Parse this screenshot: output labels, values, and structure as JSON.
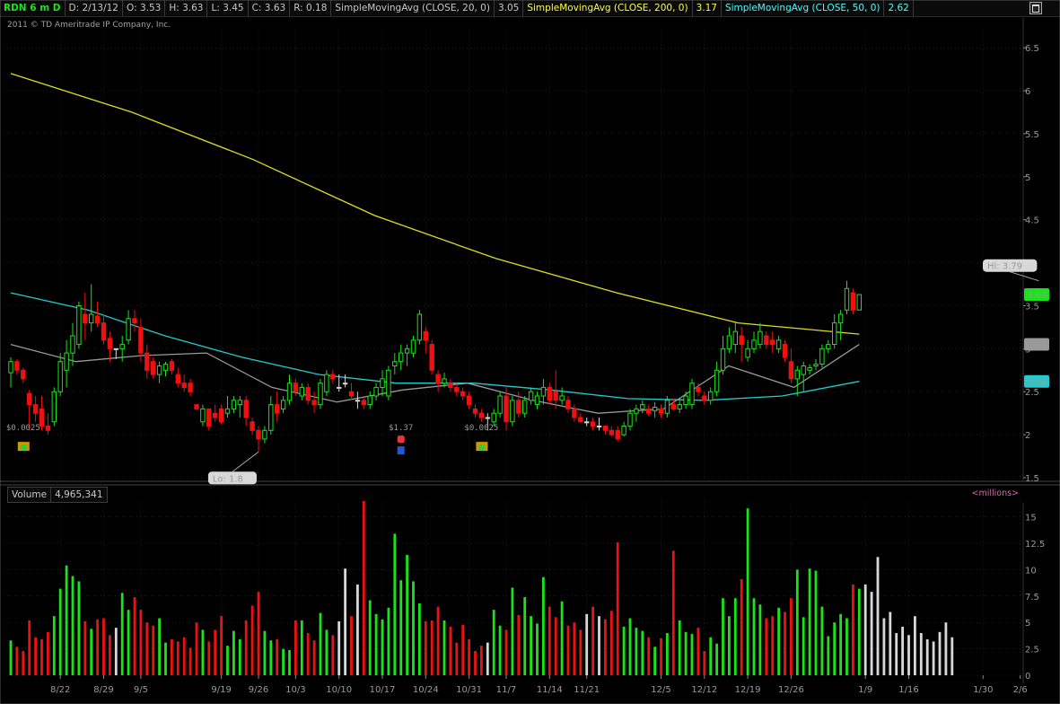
{
  "header": {
    "symbol": "RDN 6 m D",
    "date": "D: 2/13/12",
    "open": "O: 3.53",
    "high": "H: 3.63",
    "low": "L: 3.45",
    "close": "C: 3.63",
    "range": "R: 0.18",
    "sma20_label": "SimpleMovingAvg (CLOSE, 20, 0)",
    "sma20_value": "3.05",
    "sma200_label": "SimpleMovingAvg (CLOSE, 200, 0)",
    "sma200_value": "3.17",
    "sma50_label": "SimpleMovingAvg (CLOSE, 50, 0)",
    "sma50_value": "2.62"
  },
  "copyright": "2011 © TD Ameritrade IP Company, Inc.",
  "volume_header": {
    "label": "Volume",
    "value": "4,965,341",
    "units": "<millions>"
  },
  "colors": {
    "up": "#19e319",
    "down": "#ee1111",
    "flat": "#d8d8d8",
    "sma200": "#dddd22",
    "sma50": "#22cccc",
    "sma20": "#999999",
    "grid": "#3a3a3a"
  },
  "chart_data": [
    {
      "type": "candlestick",
      "title": "RDN 6 m D",
      "ylim": [
        1.5,
        6.7
      ],
      "y_ticks": [
        1.5,
        2,
        2.5,
        3,
        3.5,
        4,
        4.5,
        5,
        5.5,
        6,
        6.5
      ],
      "y_tick_labels": [
        "1.5",
        "2",
        "2.5",
        "3",
        "3.5",
        "4",
        "4.5",
        "5",
        "5.5",
        "6",
        "6.5"
      ],
      "x_tick_labels": [
        {
          "label": "8/22",
          "bar": 8
        },
        {
          "label": "8/29",
          "bar": 15
        },
        {
          "label": "9/5",
          "bar": 21
        },
        {
          "label": "9/19",
          "bar": 34
        },
        {
          "label": "9/26",
          "bar": 40
        },
        {
          "label": "10/3",
          "bar": 46
        },
        {
          "label": "10/10",
          "bar": 53
        },
        {
          "label": "10/17",
          "bar": 60
        },
        {
          "label": "10/24",
          "bar": 67
        },
        {
          "label": "10/31",
          "bar": 74
        },
        {
          "label": "11/7",
          "bar": 80
        },
        {
          "label": "11/14",
          "bar": 87
        },
        {
          "label": "11/21",
          "bar": 93
        },
        {
          "label": "12/5",
          "bar": 105
        },
        {
          "label": "12/12",
          "bar": 112
        },
        {
          "label": "12/19",
          "bar": 119
        },
        {
          "label": "12/26",
          "bar": 126
        },
        {
          "label": "1/9",
          "bar": 138
        },
        {
          "label": "1/16",
          "bar": 145
        },
        {
          "label": "1/30",
          "bar": 157
        },
        {
          "label": "2/6",
          "bar": 163
        }
      ],
      "ohlc": [
        [
          2.72,
          2.9,
          2.55,
          2.85
        ],
        [
          2.85,
          2.88,
          2.7,
          2.75
        ],
        [
          2.75,
          2.78,
          2.6,
          2.65
        ],
        [
          2.48,
          2.52,
          2.05,
          2.35
        ],
        [
          2.35,
          2.45,
          2.15,
          2.25
        ],
        [
          2.3,
          2.45,
          2.05,
          2.1
        ],
        [
          2.1,
          2.25,
          2.0,
          2.05
        ],
        [
          2.15,
          2.55,
          2.1,
          2.5
        ],
        [
          2.5,
          2.95,
          2.45,
          2.85
        ],
        [
          2.75,
          3.1,
          2.55,
          2.95
        ],
        [
          2.95,
          3.3,
          2.8,
          3.15
        ],
        [
          3.05,
          3.55,
          3.0,
          3.5
        ],
        [
          3.4,
          3.65,
          3.1,
          3.3
        ],
        [
          3.3,
          3.75,
          3.2,
          3.4
        ],
        [
          3.38,
          3.55,
          3.25,
          3.3
        ],
        [
          3.3,
          3.4,
          3.05,
          3.1
        ],
        [
          3.12,
          3.2,
          2.85,
          3.0
        ],
        [
          3.0,
          3.0,
          2.88,
          3.0
        ],
        [
          3.0,
          3.15,
          2.85,
          3.05
        ],
        [
          3.1,
          3.45,
          3.05,
          3.35
        ],
        [
          3.35,
          3.45,
          3.2,
          3.3
        ],
        [
          3.25,
          3.35,
          2.85,
          2.95
        ],
        [
          2.95,
          3.05,
          2.65,
          2.75
        ],
        [
          2.85,
          2.9,
          2.65,
          2.7
        ],
        [
          2.7,
          2.85,
          2.6,
          2.8
        ],
        [
          2.75,
          2.85,
          2.68,
          2.82
        ],
        [
          2.85,
          2.88,
          2.7,
          2.75
        ],
        [
          2.7,
          2.78,
          2.55,
          2.6
        ],
        [
          2.6,
          2.7,
          2.5,
          2.55
        ],
        [
          2.6,
          2.65,
          2.45,
          2.5
        ],
        [
          2.35,
          2.35,
          2.3,
          2.3
        ],
        [
          2.15,
          2.35,
          2.1,
          2.3
        ],
        [
          2.3,
          2.3,
          2.05,
          2.1
        ],
        [
          2.25,
          2.35,
          2.15,
          2.2
        ],
        [
          2.3,
          2.35,
          2.12,
          2.15
        ],
        [
          2.25,
          2.45,
          2.2,
          2.3
        ],
        [
          2.3,
          2.45,
          2.25,
          2.4
        ],
        [
          2.35,
          2.45,
          2.2,
          2.4
        ],
        [
          2.4,
          2.45,
          2.1,
          2.2
        ],
        [
          2.15,
          2.2,
          2.0,
          2.05
        ],
        [
          2.05,
          2.1,
          1.8,
          1.95
        ],
        [
          1.95,
          2.1,
          1.9,
          2.05
        ],
        [
          2.05,
          2.45,
          2.0,
          2.35
        ],
        [
          2.35,
          2.5,
          2.15,
          2.25
        ],
        [
          2.3,
          2.45,
          2.25,
          2.4
        ],
        [
          2.4,
          2.7,
          2.35,
          2.6
        ],
        [
          2.6,
          2.65,
          2.45,
          2.5
        ],
        [
          2.45,
          2.6,
          2.4,
          2.55
        ],
        [
          2.55,
          2.6,
          2.35,
          2.4
        ],
        [
          2.4,
          2.5,
          2.25,
          2.35
        ],
        [
          2.35,
          2.65,
          2.3,
          2.6
        ],
        [
          2.5,
          2.75,
          2.45,
          2.7
        ],
        [
          2.7,
          2.75,
          2.6,
          2.65
        ],
        [
          2.55,
          2.7,
          2.5,
          2.55
        ],
        [
          2.6,
          2.7,
          2.55,
          2.6
        ],
        [
          2.5,
          2.6,
          2.4,
          2.45
        ],
        [
          2.4,
          2.5,
          2.3,
          2.4
        ],
        [
          2.4,
          2.45,
          2.3,
          2.35
        ],
        [
          2.35,
          2.5,
          2.3,
          2.45
        ],
        [
          2.45,
          2.6,
          2.4,
          2.55
        ],
        [
          2.55,
          2.75,
          2.45,
          2.65
        ],
        [
          2.45,
          2.8,
          2.4,
          2.75
        ],
        [
          2.8,
          2.95,
          2.7,
          2.85
        ],
        [
          2.85,
          3.05,
          2.75,
          2.95
        ],
        [
          2.95,
          3.05,
          2.8,
          3.0
        ],
        [
          2.95,
          3.15,
          2.9,
          3.1
        ],
        [
          3.1,
          3.45,
          3.05,
          3.4
        ],
        [
          3.2,
          3.25,
          2.95,
          3.1
        ],
        [
          3.05,
          3.1,
          2.7,
          2.75
        ],
        [
          2.7,
          2.75,
          2.5,
          2.6
        ],
        [
          2.6,
          2.72,
          2.55,
          2.65
        ],
        [
          2.6,
          2.65,
          2.5,
          2.55
        ],
        [
          2.55,
          2.6,
          2.45,
          2.5
        ],
        [
          2.5,
          2.55,
          2.4,
          2.45
        ],
        [
          2.45,
          2.5,
          2.3,
          2.35
        ],
        [
          2.3,
          2.35,
          2.2,
          2.25
        ],
        [
          2.25,
          2.3,
          2.15,
          2.2
        ],
        [
          2.2,
          2.25,
          2.05,
          2.2
        ],
        [
          2.15,
          2.3,
          2.1,
          2.25
        ],
        [
          2.25,
          2.5,
          2.2,
          2.45
        ],
        [
          2.45,
          2.55,
          2.05,
          2.15
        ],
        [
          2.15,
          2.45,
          2.1,
          2.4
        ],
        [
          2.4,
          2.5,
          2.2,
          2.25
        ],
        [
          2.25,
          2.45,
          2.2,
          2.4
        ],
        [
          2.4,
          2.55,
          2.35,
          2.5
        ],
        [
          2.35,
          2.5,
          2.3,
          2.45
        ],
        [
          2.45,
          2.65,
          2.35,
          2.55
        ],
        [
          2.55,
          2.6,
          2.35,
          2.4
        ],
        [
          2.5,
          2.75,
          2.3,
          2.4
        ],
        [
          2.4,
          2.55,
          2.35,
          2.45
        ],
        [
          2.4,
          2.45,
          2.25,
          2.3
        ],
        [
          2.3,
          2.35,
          2.15,
          2.2
        ],
        [
          2.2,
          2.25,
          2.15,
          2.15
        ],
        [
          2.15,
          2.2,
          2.1,
          2.15
        ],
        [
          2.15,
          2.2,
          2.05,
          2.1
        ],
        [
          2.1,
          2.2,
          2.05,
          2.1
        ],
        [
          2.1,
          2.1,
          2.0,
          2.05
        ],
        [
          2.05,
          2.1,
          1.98,
          2.0
        ],
        [
          2.05,
          2.1,
          1.92,
          1.95
        ],
        [
          2.0,
          2.15,
          1.98,
          2.1
        ],
        [
          2.1,
          2.3,
          2.05,
          2.25
        ],
        [
          2.25,
          2.35,
          2.15,
          2.3
        ],
        [
          2.3,
          2.4,
          2.25,
          2.35
        ],
        [
          2.3,
          2.35,
          2.22,
          2.25
        ],
        [
          2.28,
          2.38,
          2.2,
          2.32
        ],
        [
          2.3,
          2.35,
          2.2,
          2.25
        ],
        [
          2.25,
          2.45,
          2.2,
          2.4
        ],
        [
          2.35,
          2.42,
          2.28,
          2.3
        ],
        [
          2.3,
          2.42,
          2.25,
          2.35
        ],
        [
          2.35,
          2.5,
          2.3,
          2.45
        ],
        [
          2.35,
          2.65,
          2.3,
          2.6
        ],
        [
          2.55,
          2.6,
          2.45,
          2.5
        ],
        [
          2.45,
          2.5,
          2.35,
          2.4
        ],
        [
          2.4,
          2.55,
          2.35,
          2.5
        ],
        [
          2.5,
          2.85,
          2.45,
          2.75
        ],
        [
          2.75,
          3.15,
          2.7,
          3.0
        ],
        [
          3.0,
          3.25,
          2.95,
          3.15
        ],
        [
          3.05,
          3.3,
          2.95,
          3.2
        ],
        [
          3.15,
          3.25,
          2.85,
          3.05
        ],
        [
          2.9,
          3.1,
          2.85,
          3.0
        ],
        [
          3.0,
          3.2,
          2.95,
          3.1
        ],
        [
          3.05,
          3.3,
          3.0,
          3.2
        ],
        [
          3.15,
          3.2,
          3.0,
          3.05
        ],
        [
          3.1,
          3.2,
          2.95,
          3.05
        ],
        [
          3.0,
          3.15,
          2.95,
          3.1
        ],
        [
          3.05,
          3.1,
          2.85,
          2.9
        ],
        [
          2.85,
          3.0,
          2.6,
          2.65
        ],
        [
          2.65,
          2.8,
          2.45,
          2.75
        ],
        [
          2.7,
          2.85,
          2.5,
          2.8
        ],
        [
          2.75,
          2.82,
          2.7,
          2.78
        ],
        [
          2.8,
          2.88,
          2.75,
          2.82
        ],
        [
          2.82,
          3.05,
          2.78,
          3.0
        ],
        [
          3.0,
          3.1,
          2.95,
          3.05
        ],
        [
          3.05,
          3.4,
          3.0,
          3.3
        ],
        [
          3.3,
          3.45,
          3.1,
          3.4
        ],
        [
          3.45,
          3.79,
          3.4,
          3.7
        ],
        [
          3.65,
          3.7,
          3.4,
          3.45
        ],
        [
          3.45,
          3.63,
          3.45,
          3.63
        ]
      ],
      "series": [
        {
          "name": "SimpleMovingAvg (CLOSE, 200, 0)",
          "values": [
            6.2,
            5.75,
            5.2,
            4.55,
            4.05,
            3.65,
            3.3,
            3.17
          ]
        },
        {
          "name": "SimpleMovingAvg (CLOSE, 50, 0)",
          "values": [
            3.65,
            3.45,
            3.15,
            2.9,
            2.7,
            2.6,
            2.6,
            2.52,
            2.42,
            2.4,
            2.45,
            2.62
          ]
        },
        {
          "name": "SimpleMovingAvg (CLOSE, 20, 0)",
          "values": [
            3.05,
            2.85,
            2.92,
            2.95,
            2.55,
            2.38,
            2.52,
            2.6,
            2.4,
            2.25,
            2.3,
            2.8,
            2.55,
            3.05
          ]
        }
      ],
      "annotations": [
        {
          "label": "Hi: 3.79",
          "bar": 166,
          "value": 3.79
        },
        {
          "label": "Lo: 1.8",
          "bar": 40,
          "value": 1.8
        },
        {
          "label": "$0.0025",
          "bar": 2,
          "value": 2.0,
          "icon": "dividend-icon"
        },
        {
          "label": "$1.37",
          "bar": 63,
          "value": 2.0,
          "icon": "earnings-icon"
        },
        {
          "label": "$0.0025",
          "bar": 76,
          "value": 2.0,
          "icon": "dividend-icon"
        }
      ],
      "price_markers": [
        {
          "label": "3.63",
          "value": 3.63,
          "color": "#19e319"
        },
        {
          "label": "3.05",
          "value": 3.05,
          "color": "#999999"
        },
        {
          "label": "2.62",
          "value": 2.62,
          "color": "#22cccc"
        }
      ],
      "grid": true
    },
    {
      "type": "bar",
      "title": "Volume",
      "ylabel": "<millions>",
      "ylim": [
        0,
        16.5
      ],
      "y_ticks": [
        0,
        2.5,
        5,
        7.5,
        10,
        12.5,
        15
      ],
      "y_tick_labels": [
        "0",
        "2.5",
        "5",
        "7.5",
        "10",
        "12.5",
        "15"
      ],
      "values": [
        3.3,
        2.7,
        2.3,
        5.2,
        3.6,
        3.4,
        4.1,
        5.6,
        8.2,
        10.4,
        9.4,
        8.9,
        5.1,
        4.4,
        5.3,
        5.4,
        3.8,
        4.5,
        7.8,
        6.2,
        7.4,
        6.2,
        5.0,
        4.7,
        5.4,
        3.1,
        3.4,
        3.2,
        3.6,
        2.6,
        5.0,
        4.3,
        3.2,
        4.3,
        5.6,
        2.8,
        4.2,
        3.4,
        5.2,
        6.6,
        7.9,
        4.2,
        3.3,
        3.4,
        2.5,
        2.4,
        5.2,
        5.2,
        4.0,
        3.3,
        5.9,
        4.3,
        3.8,
        5.1,
        10.1,
        5.6,
        8.6,
        16.5,
        7.1,
        5.8,
        5.3,
        6.4,
        13.4,
        9.0,
        11.4,
        8.9,
        6.8,
        5.1,
        5.2,
        6.5,
        5.2,
        4.6,
        3.1,
        4.8,
        3.4,
        2.3,
        2.8,
        3.1,
        6.2,
        4.7,
        4.3,
        8.3,
        5.7,
        7.4,
        5.6,
        4.9,
        9.3,
        6.5,
        5.5,
        7.0,
        4.7,
        5.0,
        4.3,
        5.8,
        6.5,
        5.6,
        5.3,
        6.1,
        12.6,
        4.6,
        5.4,
        4.5,
        4.2,
        3.6,
        2.7,
        3.5,
        4.0,
        11.8,
        5.2,
        4.1,
        3.9,
        4.5,
        2.3,
        3.6,
        3.0,
        7.3,
        5.6,
        7.3,
        9.1,
        15.8,
        7.3,
        6.7,
        5.4,
        5.6,
        6.4,
        6.0,
        7.3,
        10.0,
        5.5,
        10.1,
        9.9,
        6.5,
        3.7,
        5.0,
        5.8,
        5.4,
        8.6,
        8.2,
        8.6,
        7.9,
        11.2,
        5.4,
        6.0,
        4.0,
        4.6,
        3.8,
        5.6,
        4.0,
        3.4,
        3.2,
        4.1,
        5.0,
        3.6
      ],
      "grid": true
    }
  ]
}
